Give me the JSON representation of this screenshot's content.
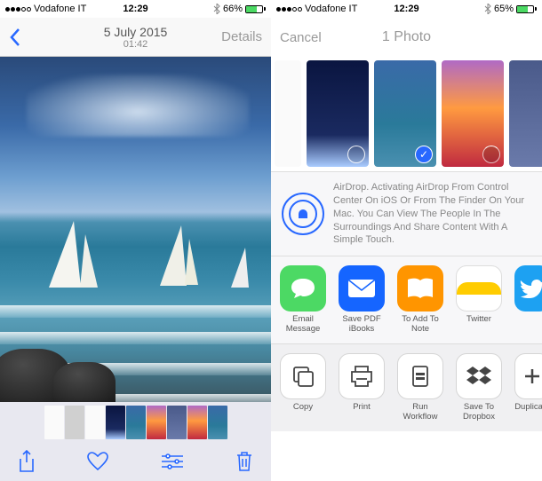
{
  "status_left": {
    "carrier": "Vodafone IT",
    "time": "12:29",
    "battery_pct": "66%"
  },
  "status_right": {
    "carrier": "Vodafone IT",
    "time": "12:29",
    "battery_pct": "65%"
  },
  "left_nav": {
    "title_line1": "5 July 2015",
    "title_line2": "01:42",
    "details": "Details"
  },
  "right_nav": {
    "title": "1 Photo",
    "cancel": "Cancel"
  },
  "airdrop": {
    "text": "AirDrop. Activating AirDrop From Control Center On iOS Or From The Finder On Your Mac. You Can View The People In The Surroundings And Share Content With A Simple Touch."
  },
  "share_apps": [
    {
      "label": "Email Message"
    },
    {
      "label": "Save PDF iBooks"
    },
    {
      "label": "To Add To Note"
    },
    {
      "label": "Twitter"
    }
  ],
  "actions": [
    {
      "label": "Copy"
    },
    {
      "label": "Print"
    },
    {
      "label": "Run Workflow"
    },
    {
      "label": "Save To Dropbox"
    },
    {
      "label": "Duplicate"
    }
  ]
}
